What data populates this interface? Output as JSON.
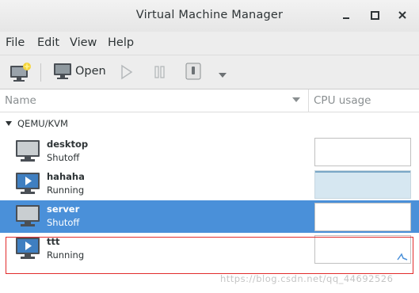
{
  "window": {
    "title": "Virtual Machine Manager",
    "controls": [
      "minimize-icon",
      "maximize-icon",
      "close-icon"
    ]
  },
  "menubar": {
    "items": [
      "File",
      "Edit",
      "View",
      "Help"
    ]
  },
  "toolbar": {
    "new_vm_icon": "new-vm-icon",
    "open_label": "Open",
    "buttons": [
      "new-vm-button",
      "open-button",
      "run-button",
      "pause-button",
      "shutdown-button",
      "shutdown-menu-button"
    ]
  },
  "columns": {
    "name": "Name",
    "cpu": "CPU usage"
  },
  "group": {
    "label": "QEMU/KVM"
  },
  "vms": [
    {
      "name": "desktop",
      "status": "Shutoff",
      "selected": false
    },
    {
      "name": "hahaha",
      "status": "Running",
      "selected": false
    },
    {
      "name": "server",
      "status": "Shutoff",
      "selected": true
    },
    {
      "name": "ttt",
      "status": "Running",
      "selected": false
    }
  ],
  "colors": {
    "selection": "#4a90d9",
    "highlight_border": "#e22b2b",
    "cpu_graph_busy": "#d6e7f1"
  },
  "watermark": "https://blog.csdn.net/qq_44692526"
}
